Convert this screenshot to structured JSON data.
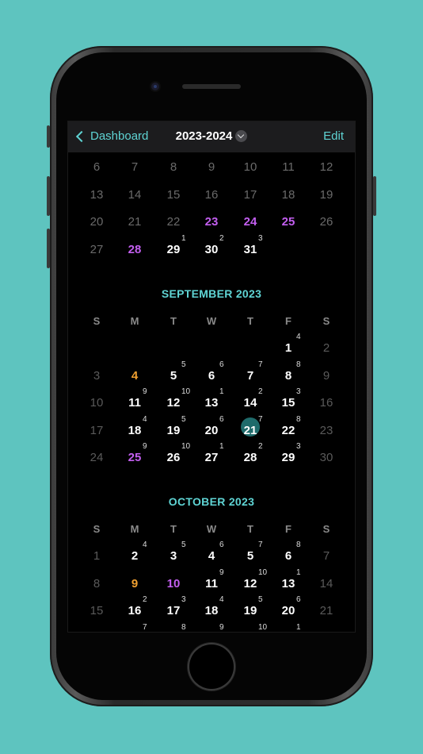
{
  "nav": {
    "back_label": "Dashboard",
    "title": "2023-2024",
    "edit_label": "Edit"
  },
  "weekday_headers": [
    "S",
    "M",
    "T",
    "W",
    "T",
    "F",
    "S"
  ],
  "colors": {
    "accent": "#5fd4d4",
    "purple": "#c35ff0",
    "orange": "#f0a030",
    "today_circle": "#1f6b6b",
    "background": "#5ec4bf"
  },
  "august_partial": {
    "rows": [
      [
        {
          "d": "6",
          "t": "past"
        },
        {
          "d": "7",
          "t": "past"
        },
        {
          "d": "8",
          "t": "past"
        },
        {
          "d": "9",
          "t": "past"
        },
        {
          "d": "10",
          "t": "past"
        },
        {
          "d": "11",
          "t": "past"
        },
        {
          "d": "12",
          "t": "past"
        }
      ],
      [
        {
          "d": "13",
          "t": "past"
        },
        {
          "d": "14",
          "t": "past"
        },
        {
          "d": "15",
          "t": "past"
        },
        {
          "d": "16",
          "t": "past"
        },
        {
          "d": "17",
          "t": "past"
        },
        {
          "d": "18",
          "t": "past"
        },
        {
          "d": "19",
          "t": "past"
        }
      ],
      [
        {
          "d": "20",
          "t": "past"
        },
        {
          "d": "21",
          "t": "past"
        },
        {
          "d": "22",
          "t": "past"
        },
        {
          "d": "23",
          "t": "purple"
        },
        {
          "d": "24",
          "t": "purple"
        },
        {
          "d": "25",
          "t": "purple"
        },
        {
          "d": "26",
          "t": "past"
        }
      ],
      [
        {
          "d": "27",
          "t": "past"
        },
        {
          "d": "28",
          "t": "purple"
        },
        {
          "d": "29",
          "t": "normal",
          "s": "1"
        },
        {
          "d": "30",
          "t": "normal",
          "s": "2"
        },
        {
          "d": "31",
          "t": "normal",
          "s": "3"
        },
        null,
        null
      ]
    ]
  },
  "september": {
    "title": "SEPTEMBER 2023",
    "rows": [
      [
        null,
        null,
        null,
        null,
        null,
        {
          "d": "1",
          "t": "normal",
          "s": "4"
        },
        {
          "d": "2",
          "t": "weekend"
        }
      ],
      [
        {
          "d": "3",
          "t": "weekend"
        },
        {
          "d": "4",
          "t": "orange"
        },
        {
          "d": "5",
          "t": "normal",
          "s": "5"
        },
        {
          "d": "6",
          "t": "normal",
          "s": "6"
        },
        {
          "d": "7",
          "t": "normal",
          "s": "7"
        },
        {
          "d": "8",
          "t": "normal",
          "s": "8"
        },
        {
          "d": "9",
          "t": "weekend"
        }
      ],
      [
        {
          "d": "10",
          "t": "weekend"
        },
        {
          "d": "11",
          "t": "normal",
          "s": "9"
        },
        {
          "d": "12",
          "t": "normal",
          "s": "10"
        },
        {
          "d": "13",
          "t": "normal",
          "s": "1"
        },
        {
          "d": "14",
          "t": "normal",
          "s": "2"
        },
        {
          "d": "15",
          "t": "normal",
          "s": "3"
        },
        {
          "d": "16",
          "t": "weekend"
        }
      ],
      [
        {
          "d": "17",
          "t": "weekend"
        },
        {
          "d": "18",
          "t": "normal",
          "s": "4"
        },
        {
          "d": "19",
          "t": "normal",
          "s": "5"
        },
        {
          "d": "20",
          "t": "normal",
          "s": "6"
        },
        {
          "d": "21",
          "t": "today",
          "s": "7"
        },
        {
          "d": "22",
          "t": "normal",
          "s": "8"
        },
        {
          "d": "23",
          "t": "weekend"
        }
      ],
      [
        {
          "d": "24",
          "t": "weekend"
        },
        {
          "d": "25",
          "t": "purple",
          "s": "9"
        },
        {
          "d": "26",
          "t": "normal",
          "s": "10"
        },
        {
          "d": "27",
          "t": "normal",
          "s": "1"
        },
        {
          "d": "28",
          "t": "normal",
          "s": "2"
        },
        {
          "d": "29",
          "t": "normal",
          "s": "3"
        },
        {
          "d": "30",
          "t": "weekend"
        }
      ]
    ]
  },
  "october": {
    "title": "OCTOBER 2023",
    "rows": [
      [
        {
          "d": "1",
          "t": "weekend"
        },
        {
          "d": "2",
          "t": "normal",
          "s": "4"
        },
        {
          "d": "3",
          "t": "normal",
          "s": "5"
        },
        {
          "d": "4",
          "t": "normal",
          "s": "6"
        },
        {
          "d": "5",
          "t": "normal",
          "s": "7"
        },
        {
          "d": "6",
          "t": "normal",
          "s": "8"
        },
        {
          "d": "7",
          "t": "weekend"
        }
      ],
      [
        {
          "d": "8",
          "t": "weekend"
        },
        {
          "d": "9",
          "t": "orange"
        },
        {
          "d": "10",
          "t": "purple"
        },
        {
          "d": "11",
          "t": "normal",
          "s": "9"
        },
        {
          "d": "12",
          "t": "normal",
          "s": "10"
        },
        {
          "d": "13",
          "t": "normal",
          "s": "1"
        },
        {
          "d": "14",
          "t": "weekend"
        }
      ],
      [
        {
          "d": "15",
          "t": "weekend"
        },
        {
          "d": "16",
          "t": "normal",
          "s": "2"
        },
        {
          "d": "17",
          "t": "normal",
          "s": "3"
        },
        {
          "d": "18",
          "t": "normal",
          "s": "4"
        },
        {
          "d": "19",
          "t": "normal",
          "s": "5"
        },
        {
          "d": "20",
          "t": "normal",
          "s": "6"
        },
        {
          "d": "21",
          "t": "weekend"
        }
      ],
      [
        null,
        {
          "d": "",
          "t": "normal",
          "s": "7"
        },
        {
          "d": "",
          "t": "normal",
          "s": "8"
        },
        {
          "d": "",
          "t": "normal",
          "s": "9"
        },
        {
          "d": "",
          "t": "normal",
          "s": "10"
        },
        {
          "d": "",
          "t": "normal",
          "s": "1"
        },
        null
      ]
    ]
  }
}
